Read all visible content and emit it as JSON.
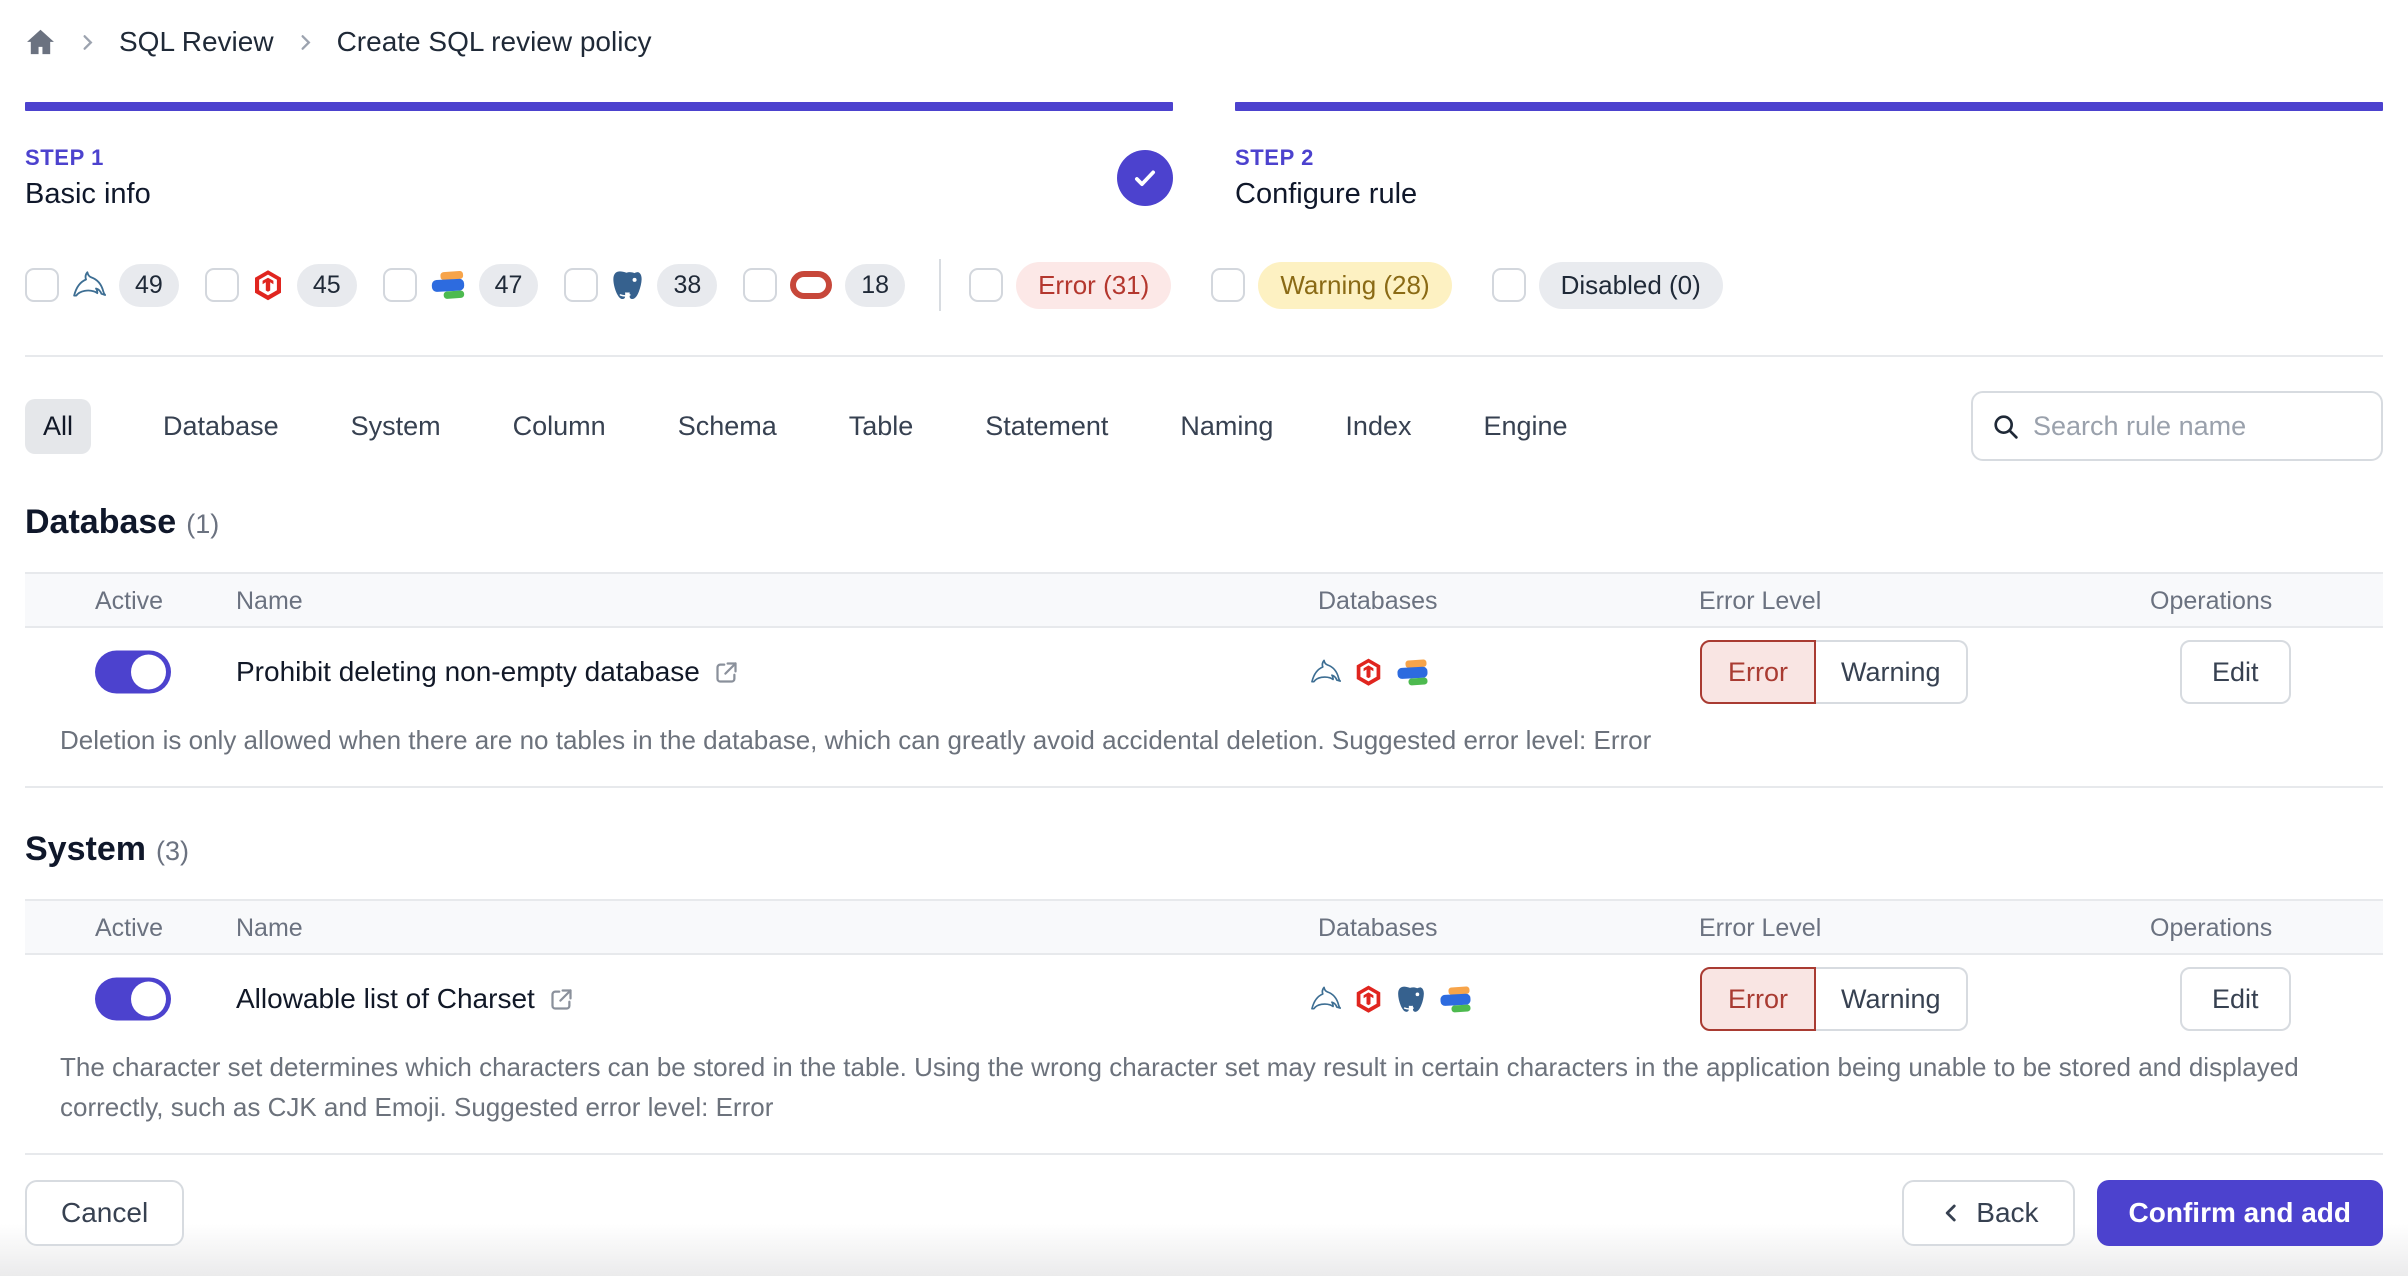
{
  "breadcrumb": {
    "items": [
      "SQL Review",
      "Create SQL review policy"
    ]
  },
  "steps": [
    {
      "label": "STEP 1",
      "title": "Basic info",
      "completed": true
    },
    {
      "label": "STEP 2",
      "title": "Configure rule",
      "completed": false
    }
  ],
  "filters": {
    "engines": [
      {
        "name": "MySQL",
        "count": "49"
      },
      {
        "name": "TiDB",
        "count": "45"
      },
      {
        "name": "OceanBase",
        "count": "47"
      },
      {
        "name": "PostgreSQL",
        "count": "38"
      },
      {
        "name": "Oracle",
        "count": "18"
      }
    ],
    "levels": [
      {
        "label": "Error (31)",
        "type": "error"
      },
      {
        "label": "Warning (28)",
        "type": "warning"
      },
      {
        "label": "Disabled (0)",
        "type": "disabled"
      }
    ]
  },
  "tabs": [
    {
      "label": "All",
      "active": true
    },
    {
      "label": "Database"
    },
    {
      "label": "System"
    },
    {
      "label": "Column"
    },
    {
      "label": "Schema"
    },
    {
      "label": "Table"
    },
    {
      "label": "Statement"
    },
    {
      "label": "Naming"
    },
    {
      "label": "Index"
    },
    {
      "label": "Engine"
    }
  ],
  "search": {
    "placeholder": "Search rule name"
  },
  "row_labels": {
    "error": "Error",
    "warning": "Warning",
    "edit": "Edit"
  },
  "columns": {
    "active": "Active",
    "name": "Name",
    "databases": "Databases",
    "error_level": "Error Level",
    "operations": "Operations"
  },
  "sections": [
    {
      "title": "Database",
      "count": "(1)",
      "rows": [
        {
          "name": "Prohibit deleting non-empty database",
          "active": true,
          "databases": [
            "MySQL",
            "TiDB",
            "OceanBase"
          ],
          "selected_level": "Error",
          "description": "Deletion is only allowed when there are no tables in the database, which can greatly avoid accidental deletion. Suggested error level: Error"
        }
      ]
    },
    {
      "title": "System",
      "count": "(3)",
      "rows": [
        {
          "name": "Allowable list of Charset",
          "active": true,
          "databases": [
            "MySQL",
            "TiDB",
            "PostgreSQL",
            "OceanBase"
          ],
          "selected_level": "Error",
          "description": "The character set determines which characters can be stored in the table. Using the wrong character set may result in certain characters in the application being unable to be stored and displayed correctly, such as CJK and Emoji. Suggested error level: Error"
        }
      ]
    }
  ],
  "footer": {
    "cancel": "Cancel",
    "back": "Back",
    "confirm": "Confirm and add"
  },
  "colors": {
    "accent": "#4C42CE",
    "error_text": "#B4372E",
    "error_bg": "#FCE8E7",
    "warning_text": "#8A6A15",
    "warning_bg": "#FDF1C2",
    "disabled_bg": "#E9EBEF"
  }
}
